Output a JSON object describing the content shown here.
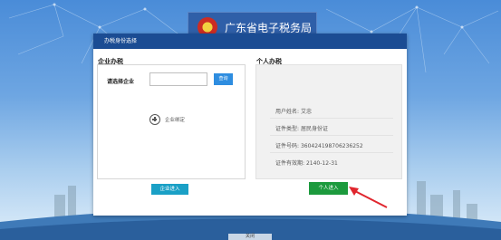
{
  "banner": {
    "title": "广东省电子税务局"
  },
  "dialog": {
    "title": "办税身份选择",
    "enterprise": {
      "section_title": "企业办税",
      "select_label": "请选择企业",
      "input_value": "",
      "search_label": "查询",
      "add_enterprise_label": "企业绑定",
      "enter_button_label": "企业进入"
    },
    "personal": {
      "section_title": "个人办税",
      "info": [
        {
          "label": "用户姓名:",
          "value": "艾忠"
        },
        {
          "label": "证件类型:",
          "value": "居民身份证"
        },
        {
          "label": "证件号码:",
          "value": "360424198706236252"
        },
        {
          "label": "证件有效期:",
          "value": "2140-12-31"
        }
      ],
      "enter_button_label": "个人进入"
    }
  },
  "footer": {
    "close_label": "关闭"
  },
  "colors": {
    "titlebar": "#1b4c93",
    "enterprise_button": "#1aa0c6",
    "personal_button": "#1c9a3d",
    "annotation_arrow": "#e0262e"
  }
}
